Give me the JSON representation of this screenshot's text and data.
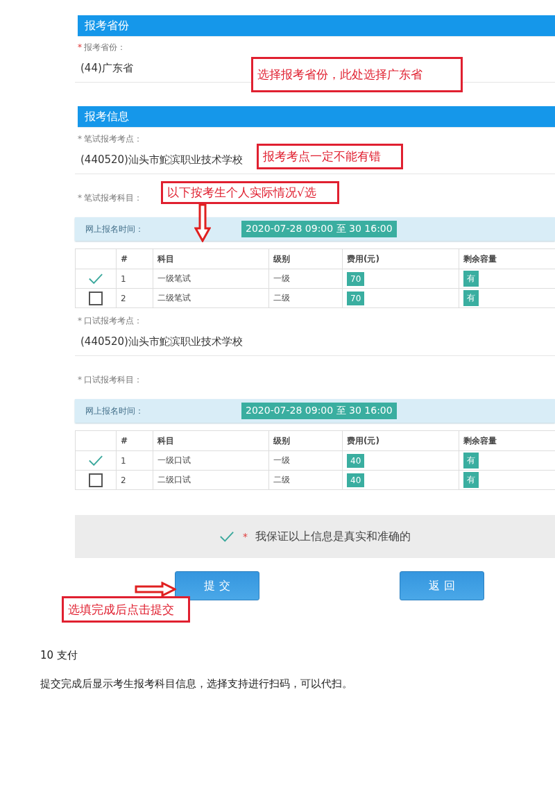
{
  "sections": [
    {
      "title": "报考省份",
      "blocks": [
        {
          "kind": "field",
          "mark": "*",
          "mark_red": true,
          "label": "报考省份：",
          "value": "(44)广东省"
        }
      ]
    },
    {
      "title": "报考信息",
      "blocks": [
        {
          "kind": "field",
          "mark": "*",
          "mark_red": false,
          "label": "笔试报考考点：",
          "value": "(440520)汕头市鮀滨职业技术学校"
        },
        {
          "kind": "subjects",
          "mark": "*",
          "label": "笔试报考科目：",
          "schedule_label": "网上报名时间：",
          "schedule_time": "2020-07-28 09:00 至 30 16:00",
          "columns": [
            "#",
            "科目",
            "级别",
            "费用(元)",
            "剩余容量"
          ],
          "rows": [
            {
              "checked": true,
              "no": "1",
              "subject": "一级笔试",
              "level": "一级",
              "fee": "70",
              "capacity": "有"
            },
            {
              "checked": false,
              "no": "2",
              "subject": "二级笔试",
              "level": "二级",
              "fee": "70",
              "capacity": "有"
            }
          ]
        },
        {
          "kind": "field",
          "mark": "*",
          "mark_red": false,
          "label": "口试报考考点：",
          "value": "(440520)汕头市鮀滨职业技术学校"
        },
        {
          "kind": "subjects",
          "mark": "*",
          "label": "口试报考科目：",
          "schedule_label": "网上报名时间：",
          "schedule_time": "2020-07-28 09:00 至 30 16:00",
          "columns": [
            "#",
            "科目",
            "级别",
            "费用(元)",
            "剩余容量"
          ],
          "rows": [
            {
              "checked": true,
              "no": "1",
              "subject": "一级口试",
              "level": "一级",
              "fee": "40",
              "capacity": "有"
            },
            {
              "checked": false,
              "no": "2",
              "subject": "二级口试",
              "level": "二级",
              "fee": "40",
              "capacity": "有"
            }
          ]
        }
      ]
    }
  ],
  "agreement": {
    "checked": true,
    "mark": "*",
    "text": "我保证以上信息是真实和准确的"
  },
  "buttons": [
    "提 交",
    "返 回"
  ],
  "annotations": [
    "选择报考省份，此处选择广东省",
    "报考考点一定不能有错",
    "以下按考生个人实际情况√选",
    "选填完成后点击提交"
  ],
  "document": {
    "heading": "10 支付",
    "paragraph": "提交完成后显示考生报考科目信息，选择支持进行扫码，可以代扫。"
  }
}
